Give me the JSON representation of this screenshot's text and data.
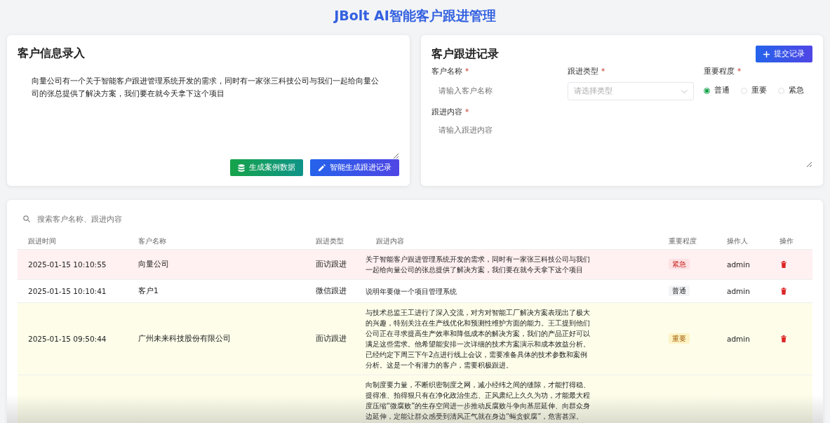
{
  "page_title": "JBolt AI智能客户跟进管理",
  "info_panel": {
    "title": "客户信息录入",
    "text": "向量公司有一个关于智能客户跟进管理系统开发的需求，同时有一家张三科技公司与我们一起给向量公司的张总提供了解决方案，我们要在就今天拿下这个项目",
    "buttons": [
      {
        "label": "生成案例数据",
        "kind": "data"
      },
      {
        "label": "智能生成跟进记录",
        "kind": "ai"
      }
    ]
  },
  "record_panel": {
    "title": "客户跟进记录",
    "submit": "提交记录",
    "customer_field": {
      "label": "客户名称",
      "required_mark": "*",
      "placeholder": "请输入客户名称"
    },
    "type_field": {
      "label": "跟进类型",
      "required_mark": "*",
      "placeholder": "请选择类型"
    },
    "importance_field": {
      "label": "重要程度",
      "required_mark": "*",
      "options": [
        {
          "label": "普通",
          "selected": true
        },
        {
          "label": "重要",
          "selected": false
        },
        {
          "label": "紧急",
          "selected": false
        }
      ]
    },
    "content_field": {
      "label": "跟进内容",
      "required_mark": "*",
      "placeholder": "请输入跟进内容"
    }
  },
  "table": {
    "search": {
      "placeholder": "搜索客户名称、跟进内容"
    },
    "columns": [
      "跟进时间",
      "客户名称",
      "跟进类型",
      "跟进内容",
      "重要程度",
      "操作人",
      "操作"
    ],
    "rows": [
      {
        "kind": "urgent",
        "time": "2025-01-15 10:10:55",
        "customer": "向量公司",
        "type": "面访跟进",
        "content": "关于智能客户跟进管理系统开发的需求，同时有一家张三科技公司与我们一起给向量公司的张总提供了解决方案，我们要在就今天拿下这个项目",
        "tag": "紧急",
        "operator": "admin"
      },
      {
        "kind": "normal",
        "time": "2025-01-15 10:10:41",
        "customer": "客户1",
        "type": "微信跟进",
        "content": "说明年要做一个项目管理系统",
        "tag": "普通",
        "operator": "admin"
      },
      {
        "kind": "important",
        "time": "2025-01-15 09:50:44",
        "customer": "广州未来科技股份有限公司",
        "type": "面访跟进",
        "content": "与技术总监王工进行了深入交流，对方对智能工厂解决方案表现出了极大的兴趣，特别关注在生产线优化和预测性维护方面的能力。王工提到他们公司正在寻求提高生产效率和降低成本的解决方案，我们的产品正好可以满足这些需求。他希望能安排一次详细的技术方案演示和成本效益分析。已经约定下周三下午2点进行线上会议，需要准备具体的技术参数和案例分析。这是一个有潜力的客户，需要积极跟进。",
        "tag": "重要",
        "operator": "admin"
      },
      {
        "kind": "important",
        "content": "向制度要力量，不断织密制度之网，减小经纬之间的缝隙，才能打得稳、提得准、拍得狠只有在净化政治生态、正风肃纪上久久为功，才能最大程度压缩“微腐败”的生存空间进一步推动反腐败斗争向基层延伸、向群众身边延伸，定能让群众感受到清风正气就在身边“蝇贪蚁腐”，危害甚深。"
      }
    ]
  }
}
